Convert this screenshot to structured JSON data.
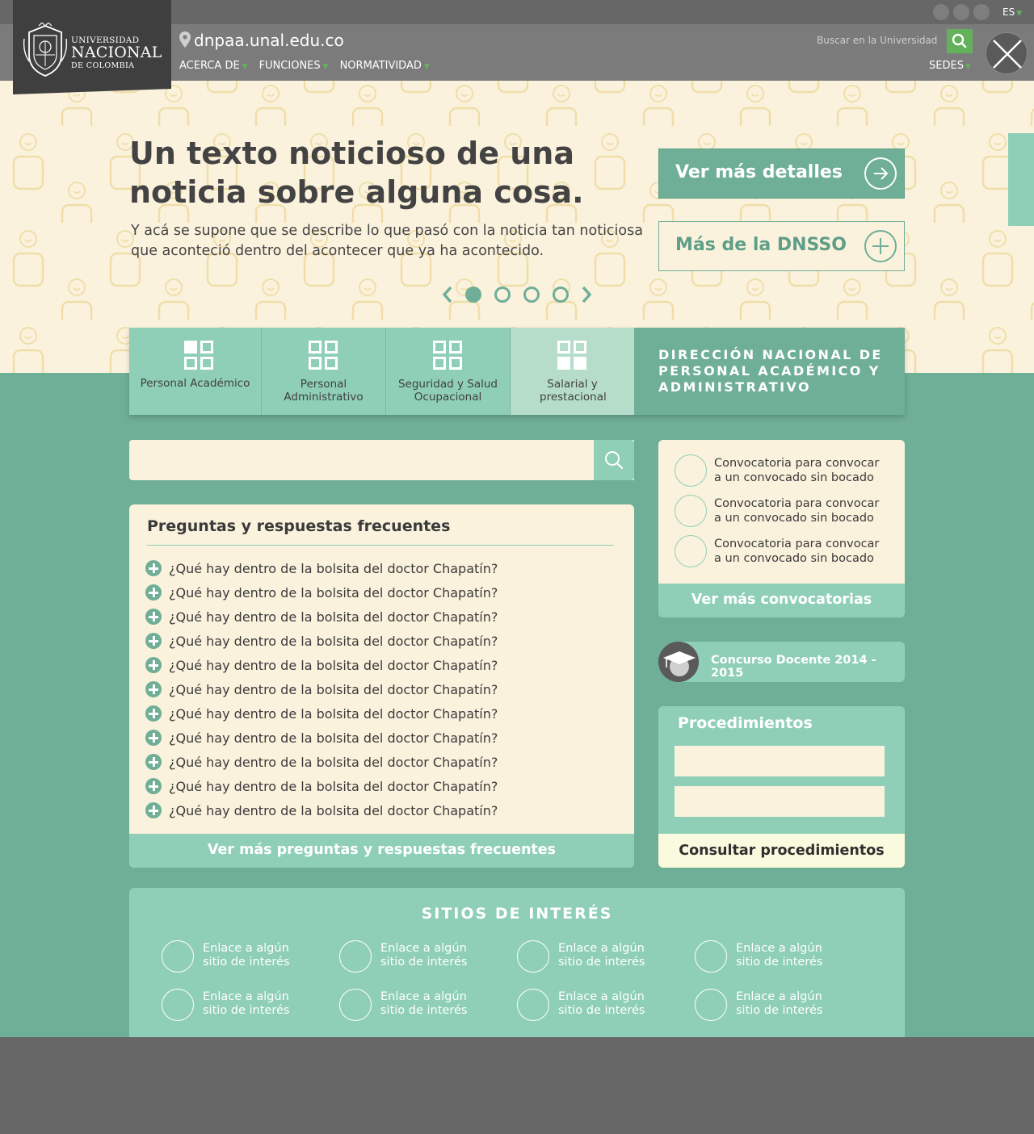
{
  "header": {
    "language": "ES",
    "domain": "dnpaa.unal.edu.co",
    "logo": {
      "line1": "UNIVERSIDAD",
      "line2": "NACIONAL",
      "line3": "DE COLOMBIA"
    },
    "menu": [
      "ACERCA DE",
      "FUNCIONES",
      "NORMATIVIDAD"
    ],
    "search_placeholder": "Buscar en la Universidad",
    "sedes": "SEDES"
  },
  "hero": {
    "title": "Un texto noticioso de una noticia sobre alguna cosa.",
    "description": "Y acá se supone que se describe lo que pasó con la noticia tan noticiosa que aconteció dentro del acontecer que ya ha acontecido.",
    "button_primary": "Ver más detalles",
    "button_secondary": "Más de la DNSSO",
    "slides": 4,
    "active_slide": 1
  },
  "categories": [
    {
      "label": "Personal Académico"
    },
    {
      "label": "Personal Administrativo"
    },
    {
      "label": "Seguridad y Salud Ocupacional"
    },
    {
      "label": "Salarial y prestacional"
    }
  ],
  "section_title": "DIRECCIÓN NACIONAL DE PERSONAL ACADÉMICO Y ADMINISTRATIVO",
  "search": {
    "value": ""
  },
  "faq": {
    "title": "Preguntas y respuestas frecuentes",
    "items": [
      "¿Qué hay dentro de la bolsita del doctor Chapatín?",
      "¿Qué hay dentro de la bolsita del doctor Chapatín?",
      "¿Qué hay dentro de la bolsita del doctor Chapatín?",
      "¿Qué hay dentro de la bolsita del doctor Chapatín?",
      "¿Qué hay dentro de la bolsita del doctor Chapatín?",
      "¿Qué hay dentro de la bolsita del doctor Chapatín?",
      "¿Qué hay dentro de la bolsita del doctor Chapatín?",
      "¿Qué hay dentro de la bolsita del doctor Chapatín?",
      "¿Qué hay dentro de la bolsita del doctor Chapatín?",
      "¿Qué hay dentro de la bolsita del doctor Chapatín?",
      "¿Qué hay dentro de la bolsita del doctor Chapatín?"
    ],
    "more": "Ver más preguntas y respuestas frecuentes"
  },
  "convocatorias": {
    "items": [
      {
        "line1": "Convocatoria para convocar",
        "line2": "a un convocado sin bocado"
      },
      {
        "line1": "Convocatoria para convocar",
        "line2": "a un convocado sin bocado"
      },
      {
        "line1": "Convocatoria para convocar",
        "line2": "a un convocado sin bocado"
      }
    ],
    "more": "Ver más convocatorias"
  },
  "concurso": {
    "label": "Concurso Docente 2014 - 2015"
  },
  "procedimientos": {
    "title": "Procedimientos",
    "button": "Consultar procedimientos"
  },
  "sitios": {
    "title": "SITIOS DE INTERÉS",
    "links": [
      {
        "line1": "Enlace a algún",
        "line2": "sitio de interés"
      },
      {
        "line1": "Enlace a algún",
        "line2": "sitio de interés"
      },
      {
        "line1": "Enlace a algún",
        "line2": "sitio de interés"
      },
      {
        "line1": "Enlace a algún",
        "line2": "sitio de interés"
      },
      {
        "line1": "Enlace a algún",
        "line2": "sitio de interés"
      },
      {
        "line1": "Enlace a algún",
        "line2": "sitio de interés"
      },
      {
        "line1": "Enlace a algún",
        "line2": "sitio de interés"
      },
      {
        "line1": "Enlace a algún",
        "line2": "sitio de interés"
      }
    ]
  },
  "colors": {
    "green_dark": "#6fae97",
    "green_light": "#8fcfb7",
    "cream": "#fbf2dd",
    "accent": "#63b15b",
    "header_gray": "#7b7b7b"
  }
}
